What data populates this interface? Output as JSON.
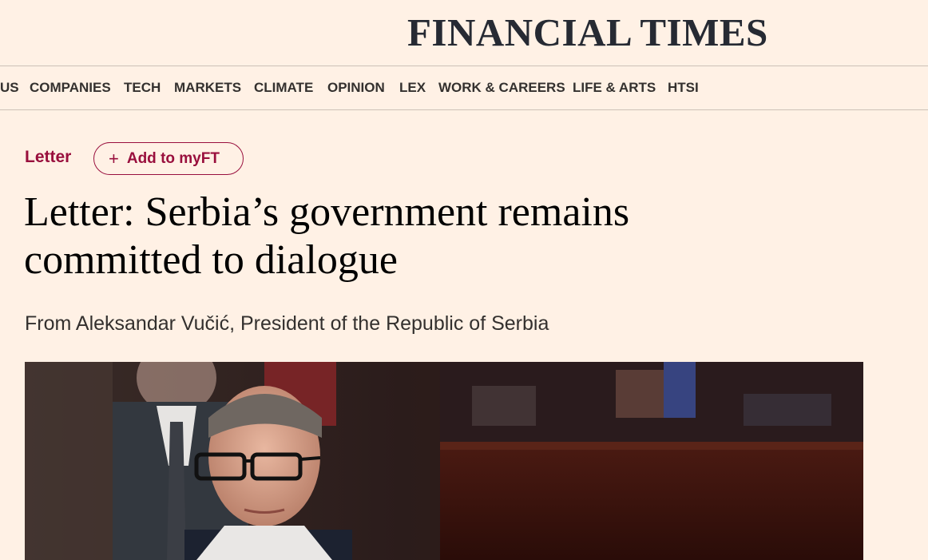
{
  "masthead": {
    "logo_text": "FINANCIAL TIMES"
  },
  "nav": {
    "items": [
      {
        "label": "US"
      },
      {
        "label": "COMPANIES"
      },
      {
        "label": "TECH"
      },
      {
        "label": "MARKETS"
      },
      {
        "label": "CLIMATE"
      },
      {
        "label": "OPINION"
      },
      {
        "label": "LEX"
      },
      {
        "label": "WORK & CAREERS"
      },
      {
        "label": "LIFE & ARTS"
      },
      {
        "label": "HTSI"
      }
    ]
  },
  "article": {
    "tag": "Letter",
    "myft_button": {
      "icon": "plus-icon",
      "label": "Add to myFT"
    },
    "headline": "Letter: Serbia’s government remains committed to dialogue",
    "standfirst": "From Aleksandar Vučić, President of the Republic of Serbia",
    "hero_image": {
      "subject": "man with glasses in suit in a parliament chamber"
    }
  },
  "colors": {
    "background": "#fff1e5",
    "accent": "#990f3d",
    "text": "#33302e",
    "divider": "#ccc1b7"
  }
}
